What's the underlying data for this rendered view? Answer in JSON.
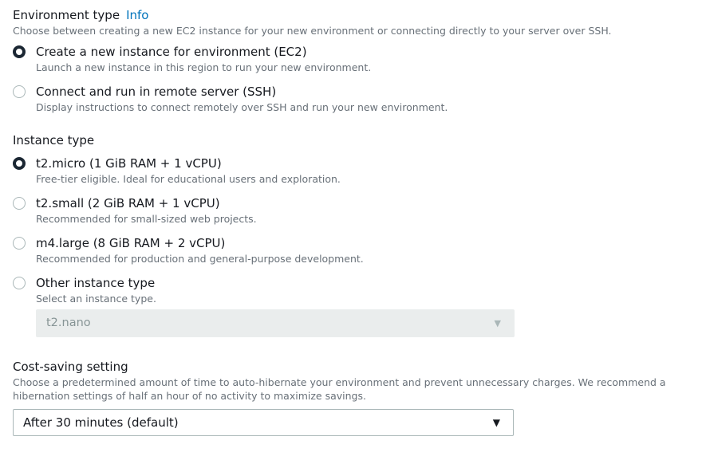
{
  "environment_type": {
    "label": "Environment type",
    "info_link": "Info",
    "description": "Choose between creating a new EC2 instance for your new environment or connecting directly to your server over SSH.",
    "options": [
      {
        "title": "Create a new instance for environment (EC2)",
        "description": "Launch a new instance in this region to run your new environment.",
        "selected": true
      },
      {
        "title": "Connect and run in remote server (SSH)",
        "description": "Display instructions to connect remotely over SSH and run your new environment.",
        "selected": false
      }
    ]
  },
  "instance_type": {
    "label": "Instance type",
    "options": [
      {
        "title": "t2.micro (1 GiB RAM + 1 vCPU)",
        "description": "Free-tier eligible. Ideal for educational users and exploration.",
        "selected": true
      },
      {
        "title": "t2.small (2 GiB RAM + 1 vCPU)",
        "description": "Recommended for small-sized web projects.",
        "selected": false
      },
      {
        "title": "m4.large (8 GiB RAM + 2 vCPU)",
        "description": "Recommended for production and general-purpose development.",
        "selected": false
      },
      {
        "title": "Other instance type",
        "description": "Select an instance type.",
        "selected": false
      }
    ],
    "other_select": {
      "value": "t2.nano",
      "disabled": true
    }
  },
  "cost_saving": {
    "label": "Cost-saving setting",
    "description": "Choose a predetermined amount of time to auto-hibernate your environment and prevent unnecessary charges. We recommend a hibernation settings of half an hour of no activity to maximize savings.",
    "select": {
      "value": "After 30 minutes (default)"
    }
  },
  "icons": {
    "caret": "▼"
  },
  "colors": {
    "link": "#0073bb",
    "text": "#16191f",
    "secondary_text": "#687078",
    "radio_checked": "#1b2733",
    "disabled_bg": "#eaeded"
  }
}
